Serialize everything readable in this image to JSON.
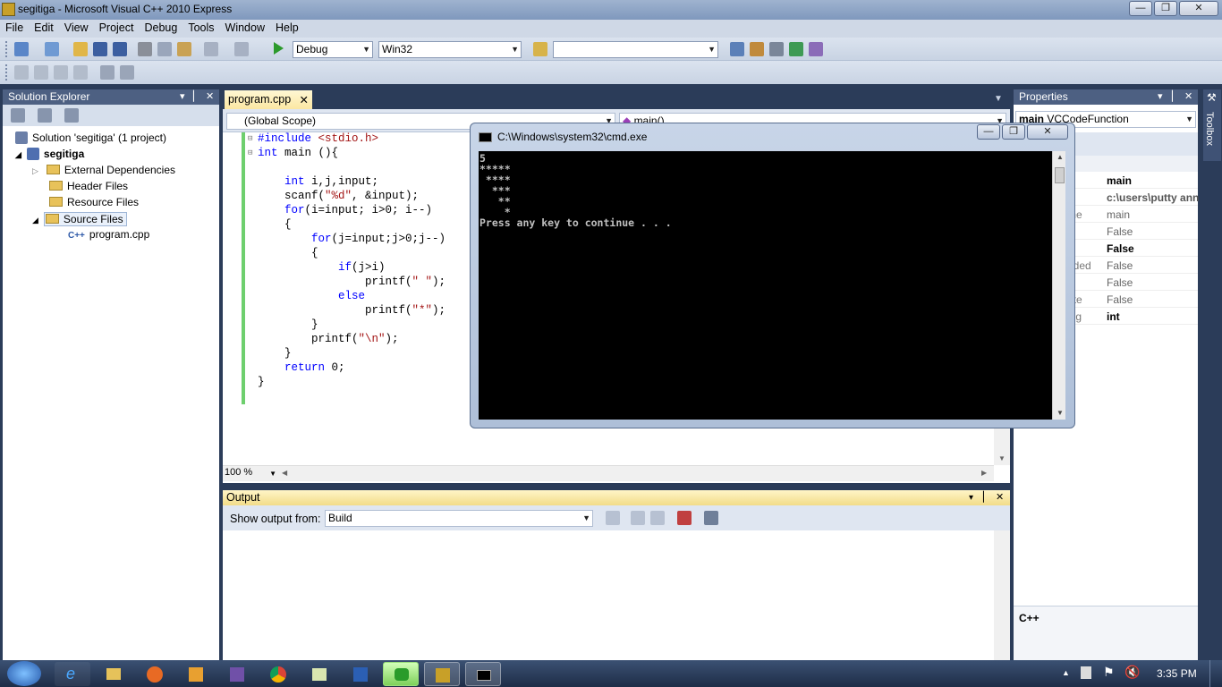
{
  "window": {
    "title": "segitiga - Microsoft Visual C++ 2010 Express"
  },
  "menu": [
    "File",
    "Edit",
    "View",
    "Project",
    "Debug",
    "Tools",
    "Window",
    "Help"
  ],
  "toolbar": {
    "config": "Debug",
    "platform": "Win32",
    "find_value": ""
  },
  "solution_explorer": {
    "title": "Solution Explorer",
    "solution": "Solution 'segitiga' (1 project)",
    "project": "segitiga",
    "folders": [
      "External Dependencies",
      "Header Files",
      "Resource Files",
      "Source Files"
    ],
    "file": "program.cpp"
  },
  "editor": {
    "tab": "program.cpp",
    "scope": "(Global Scope)",
    "member": "main()",
    "zoom": "100 %",
    "lines": [
      "#include <stdio.h>",
      "int main (){",
      "",
      "    int i,j,input;",
      "    scanf(\"%d\", &input);",
      "    for(i=input; i>0; i--)",
      "    {",
      "        for(j=input;j>0;j--)",
      "        {",
      "            if(j>i)",
      "                printf(\" \");",
      "            else",
      "                printf(\"*\");",
      "        }",
      "        printf(\"\\n\");",
      "    }",
      "    return 0;",
      "}"
    ]
  },
  "cmd": {
    "title": "C:\\Windows\\system32\\cmd.exe",
    "lines": [
      "5",
      "*****",
      " ****",
      "  ***",
      "   **",
      "    *",
      "Press any key to continue . . ."
    ]
  },
  "properties": {
    "title": "Properties",
    "object": "main",
    "object_type": "VCCodeFunction",
    "rows": [
      {
        "name": "",
        "value": "main",
        "bold": true
      },
      {
        "name": "",
        "value": "c:\\users\\putty ann",
        "bold": true
      },
      {
        "name": "me",
        "value": "main",
        "bold": false
      },
      {
        "name": "d",
        "value": "False",
        "bold": false
      },
      {
        "name": "",
        "value": "False",
        "bold": true
      },
      {
        "name": "aded",
        "value": "False",
        "bold": false
      },
      {
        "name": "",
        "value": "False",
        "bold": false
      },
      {
        "name": "ate",
        "value": "False",
        "bold": false
      },
      {
        "name": "ing",
        "value": "int",
        "bold": true
      }
    ],
    "description": "C++"
  },
  "output": {
    "title": "Output",
    "show_from_label": "Show output from:",
    "source": "Build"
  },
  "taskbar": {
    "time": "3:35 PM"
  },
  "colors": {
    "accent": "#4d6082",
    "chrome": "#2b3c59",
    "output_header": "#f4e7b0"
  }
}
